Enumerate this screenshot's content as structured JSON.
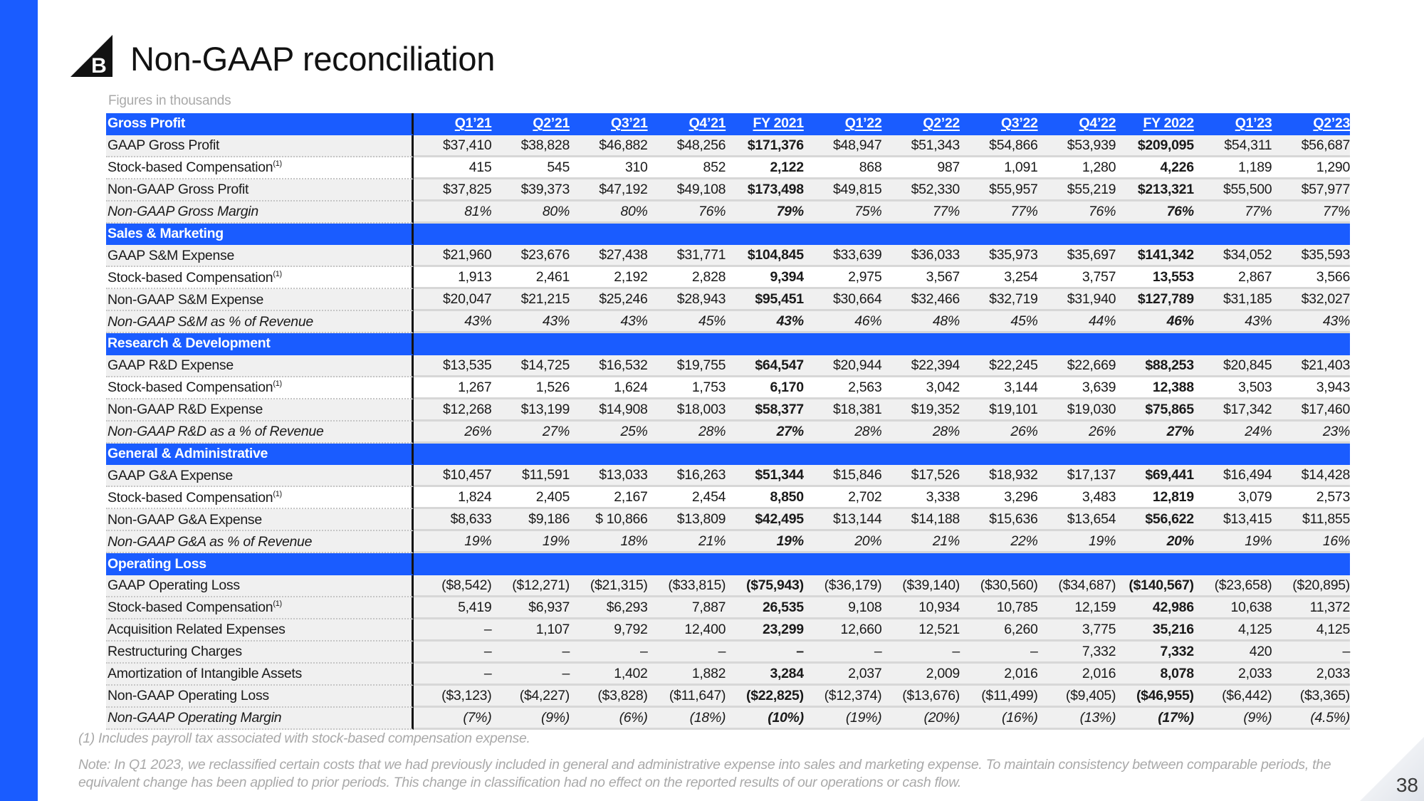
{
  "slide": {
    "title": "Non-GAAP reconciliation",
    "subtitle": "Figures in thousands",
    "page_number": "38",
    "brand_color": "#1a5cff",
    "logo_letter": "B"
  },
  "table": {
    "columns": [
      "Q1’21",
      "Q2’21",
      "Q3’21",
      "Q4’21",
      "FY 2021",
      "Q1’22",
      "Q2’22",
      "Q3’22",
      "Q4’22",
      "FY 2022",
      "Q1’23",
      "Q2’23"
    ],
    "sections": [
      {
        "title": "Gross Profit",
        "rows": [
          {
            "label": "GAAP Gross Profit",
            "footnote": "",
            "values": [
              "$37,410",
              "$38,828",
              "$46,882",
              "$48,256",
              "$171,376",
              "$48,947",
              "$51,343",
              "$54,866",
              "$53,939",
              "$209,095",
              "$54,311",
              "$56,687"
            ]
          },
          {
            "label": "Stock-based Compensation",
            "footnote": "(1)",
            "values": [
              "415",
              "545",
              "310",
              "852",
              "2,122",
              "868",
              "987",
              "1,091",
              "1,280",
              "4,226",
              "1,189",
              "1,290"
            ]
          },
          {
            "label": "Non-GAAP Gross Profit",
            "footnote": "",
            "values": [
              "$37,825",
              "$39,373",
              "$47,192",
              "$49,108",
              "$173,498",
              "$49,815",
              "$52,330",
              "$55,957",
              "$55,219",
              "$213,321",
              "$55,500",
              "$57,977"
            ]
          },
          {
            "label": "Non-GAAP Gross Margin",
            "footnote": "",
            "values": [
              "81%",
              "80%",
              "80%",
              "76%",
              "79%",
              "75%",
              "77%",
              "77%",
              "76%",
              "76%",
              "77%",
              "77%"
            ]
          }
        ]
      },
      {
        "title": "Sales & Marketing",
        "rows": [
          {
            "label": "GAAP S&M Expense",
            "footnote": "",
            "values": [
              "$21,960",
              "$23,676",
              "$27,438",
              "$31,771",
              "$104,845",
              "$33,639",
              "$36,033",
              "$35,973",
              "$35,697",
              "$141,342",
              "$34,052",
              "$35,593"
            ]
          },
          {
            "label": "Stock-based Compensation",
            "footnote": "(1)",
            "values": [
              "1,913",
              "2,461",
              "2,192",
              "2,828",
              "9,394",
              "2,975",
              "3,567",
              "3,254",
              "3,757",
              "13,553",
              "2,867",
              "3,566"
            ]
          },
          {
            "label": "Non-GAAP S&M Expense",
            "footnote": "",
            "values": [
              "$20,047",
              "$21,215",
              "$25,246",
              "$28,943",
              "$95,451",
              "$30,664",
              "$32,466",
              "$32,719",
              "$31,940",
              "$127,789",
              "$31,185",
              "$32,027"
            ]
          },
          {
            "label": "Non-GAAP S&M as % of Revenue",
            "footnote": "",
            "values": [
              "43%",
              "43%",
              "43%",
              "45%",
              "43%",
              "46%",
              "48%",
              "45%",
              "44%",
              "46%",
              "43%",
              "43%"
            ]
          }
        ]
      },
      {
        "title": "Research & Development",
        "rows": [
          {
            "label": "GAAP R&D Expense",
            "footnote": "",
            "values": [
              "$13,535",
              "$14,725",
              "$16,532",
              "$19,755",
              "$64,547",
              "$20,944",
              "$22,394",
              "$22,245",
              "$22,669",
              "$88,253",
              "$20,845",
              "$21,403"
            ]
          },
          {
            "label": "Stock-based Compensation",
            "footnote": "(1)",
            "values": [
              "1,267",
              "1,526",
              "1,624",
              "1,753",
              "6,170",
              "2,563",
              "3,042",
              "3,144",
              "3,639",
              "12,388",
              "3,503",
              "3,943"
            ]
          },
          {
            "label": "Non-GAAP R&D Expense",
            "footnote": "",
            "values": [
              "$12,268",
              "$13,199",
              "$14,908",
              "$18,003",
              "$58,377",
              "$18,381",
              "$19,352",
              "$19,101",
              "$19,030",
              "$75,865",
              "$17,342",
              "$17,460"
            ]
          },
          {
            "label": "Non-GAAP R&D as a % of Revenue",
            "footnote": "",
            "values": [
              "26%",
              "27%",
              "25%",
              "28%",
              "27%",
              "28%",
              "28%",
              "26%",
              "26%",
              "27%",
              "24%",
              "23%"
            ]
          }
        ]
      },
      {
        "title": "General & Administrative",
        "rows": [
          {
            "label": "GAAP G&A Expense",
            "footnote": "",
            "values": [
              "$10,457",
              "$11,591",
              "$13,033",
              "$16,263",
              "$51,344",
              "$15,846",
              "$17,526",
              "$18,932",
              "$17,137",
              "$69,441",
              "$16,494",
              "$14,428"
            ]
          },
          {
            "label": "Stock-based Compensation",
            "footnote": "(1)",
            "values": [
              "1,824",
              "2,405",
              "2,167",
              "2,454",
              "8,850",
              "2,702",
              "3,338",
              "3,296",
              "3,483",
              "12,819",
              "3,079",
              "2,573"
            ]
          },
          {
            "label": "Non-GAAP G&A Expense",
            "footnote": "",
            "values": [
              "$8,633",
              "$9,186",
              "$ 10,866",
              "$13,809",
              "$42,495",
              "$13,144",
              "$14,188",
              "$15,636",
              "$13,654",
              "$56,622",
              "$13,415",
              "$11,855"
            ]
          },
          {
            "label": "Non-GAAP G&A as % of Revenue",
            "footnote": "",
            "values": [
              "19%",
              "19%",
              "18%",
              "21%",
              "19%",
              "20%",
              "21%",
              "22%",
              "19%",
              "20%",
              "19%",
              "16%"
            ]
          }
        ]
      },
      {
        "title": "Operating Loss",
        "rows": [
          {
            "label": "GAAP Operating Loss",
            "footnote": "",
            "values": [
              "($8,542)",
              "($12,271)",
              "($21,315)",
              "($33,815)",
              "($75,943)",
              "($36,179)",
              "($39,140)",
              "($30,560)",
              "($34,687)",
              "($140,567)",
              "($23,658)",
              "($20,895)"
            ]
          },
          {
            "label": "Stock-based Compensation",
            "footnote": "(1)",
            "values": [
              "5,419",
              "$6,937",
              "$6,293",
              "7,887",
              "26,535",
              "9,108",
              "10,934",
              "10,785",
              "12,159",
              "42,986",
              "10,638",
              "11,372"
            ]
          },
          {
            "label": "Acquisition Related Expenses",
            "footnote": "",
            "values": [
              "–",
              "1,107",
              "9,792",
              "12,400",
              "23,299",
              "12,660",
              "12,521",
              "6,260",
              "3,775",
              "35,216",
              "4,125",
              "4,125"
            ]
          },
          {
            "label": "Restructuring Charges",
            "footnote": "",
            "values": [
              "–",
              "–",
              "–",
              "–",
              "–",
              "–",
              "–",
              "–",
              "7,332",
              "7,332",
              "420",
              "–"
            ]
          },
          {
            "label": "Amortization of Intangible Assets",
            "footnote": "",
            "values": [
              "–",
              "–",
              "1,402",
              "1,882",
              "3,284",
              "2,037",
              "2,009",
              "2,016",
              "2,016",
              "8,078",
              "2,033",
              "2,033"
            ]
          },
          {
            "label": "Non-GAAP Operating Loss",
            "footnote": "",
            "values": [
              "($3,123)",
              "($4,227)",
              "($3,828)",
              "($11,647)",
              "($22,825)",
              "($12,374)",
              "($13,676)",
              "($11,499)",
              "($9,405)",
              "($46,955)",
              "($6,442)",
              "($3,365)"
            ]
          },
          {
            "label": "Non-GAAP Operating Margin",
            "footnote": "",
            "values": [
              "(7%)",
              "(9%)",
              "(6%)",
              "(18%)",
              "(10%)",
              "(19%)",
              "(20%)",
              "(16%)",
              "(13%)",
              "(17%)",
              "(9%)",
              "(4.5%)"
            ]
          }
        ]
      }
    ]
  },
  "footnotes": {
    "note1": "(1) Includes payroll tax associated with stock-based compensation expense.",
    "note2": "Note: In Q1 2023, we reclassified certain costs that we had previously included in general and administrative expense into sales and marketing expense. To maintain consistency between comparable periods, the equivalent change has been applied to prior periods. This change in classification had no effect on the reported results of our operations or cash flow."
  }
}
